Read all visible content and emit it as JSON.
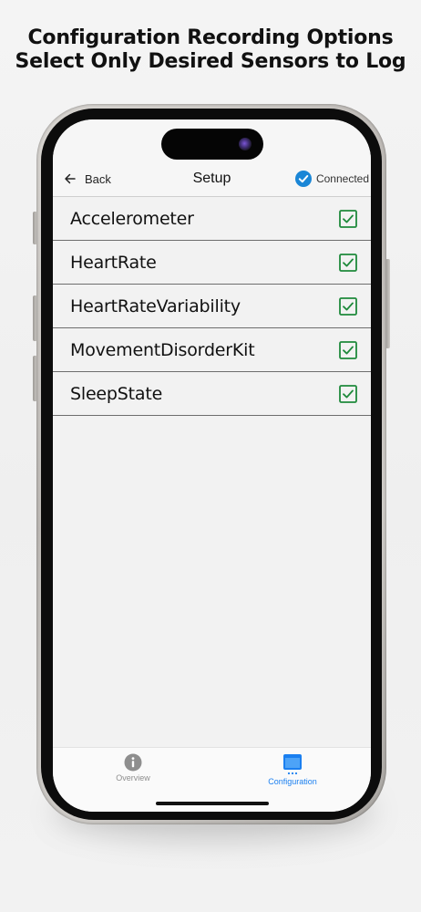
{
  "headline": {
    "line1": "Configuration Recording Options",
    "line2": "Select Only Desired Sensors to Log"
  },
  "navbar": {
    "back_label": "Back",
    "title": "Setup",
    "status_label": "Connected",
    "status_color": "#1a86d6"
  },
  "sensors": [
    {
      "label": "Accelerometer",
      "checked": true
    },
    {
      "label": "HeartRate",
      "checked": true
    },
    {
      "label": "HeartRateVariability",
      "checked": true
    },
    {
      "label": "MovementDisorderKit",
      "checked": true
    },
    {
      "label": "SleepState",
      "checked": true
    }
  ],
  "checkbox_color": "#1f8a3c",
  "tabbar": {
    "tabs": [
      {
        "label": "Overview",
        "icon": "info-icon",
        "active": false
      },
      {
        "label": "Configuration",
        "icon": "configuration-icon",
        "active": true
      }
    ],
    "active_color": "#1a7ff0",
    "inactive_color": "#8e8e8e"
  }
}
